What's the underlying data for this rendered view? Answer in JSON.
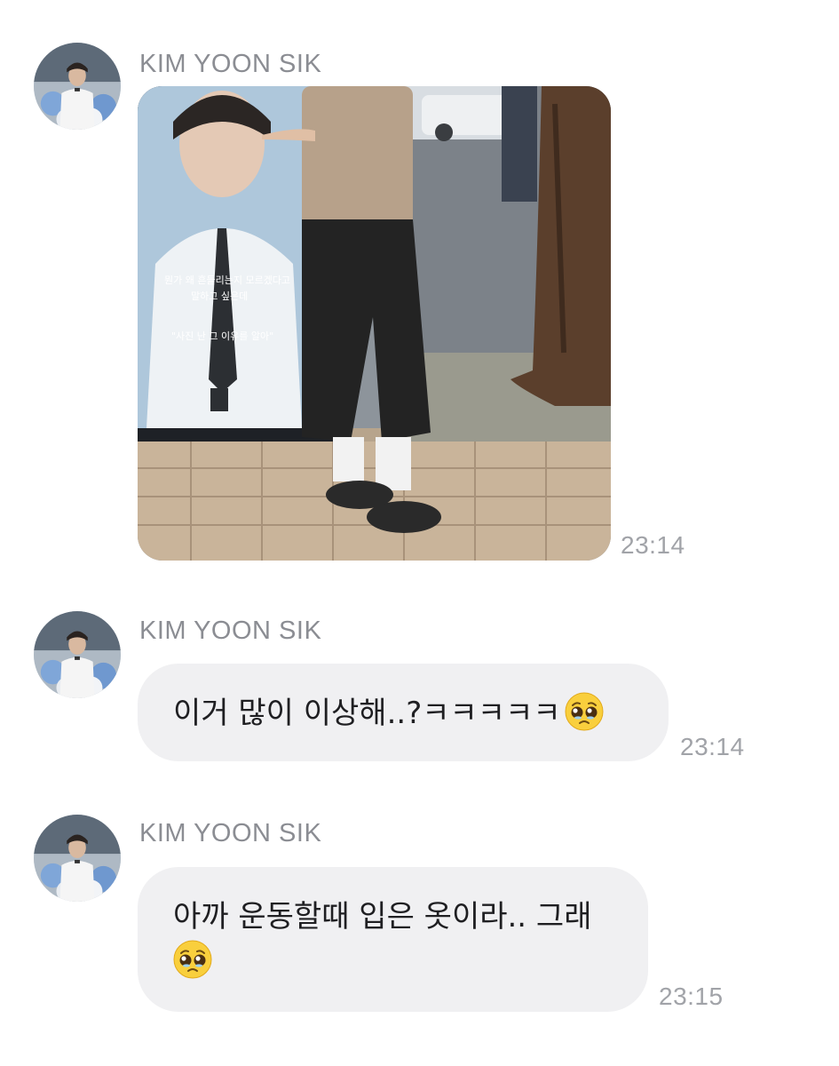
{
  "messages": [
    {
      "sender": "KIM YOON SIK",
      "type": "image",
      "image_description": "photo",
      "poster_text": {
        "line1": "뭔가 왜 흔들리는지 모르겠다고",
        "line2": "말하고 싶은데",
        "quote": "\"사진 난 그 이유를 알아\""
      },
      "time": "23:14"
    },
    {
      "sender": "KIM YOON SIK",
      "type": "text",
      "text": "이거 많이 이상해..?ㅋㅋㅋㅋㅋ",
      "emoji": "pleading-face",
      "time": "23:14"
    },
    {
      "sender": "KIM YOON SIK",
      "type": "text",
      "text": "아까 운동할때 입은 옷이라.. 그래",
      "emoji": "pleading-face",
      "time": "23:15"
    }
  ],
  "colors": {
    "sender": "#8b8d93",
    "time": "#a1a3a8",
    "bubble": "#f0f0f2",
    "text": "#1f1f22"
  }
}
